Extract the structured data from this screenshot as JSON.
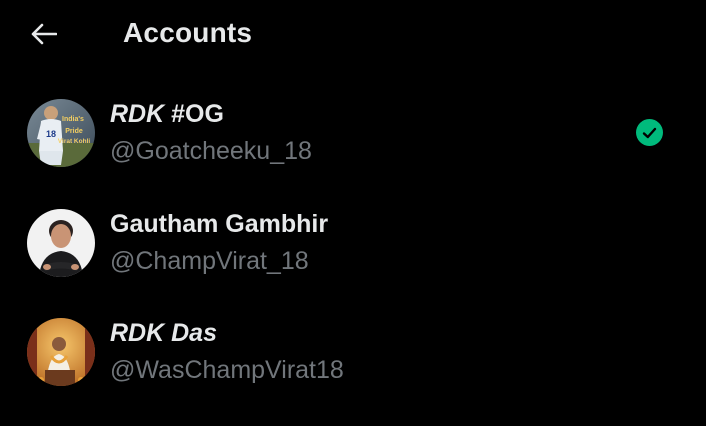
{
  "header": {
    "title": "Accounts",
    "back_icon": "arrow-left-icon"
  },
  "accounts": [
    {
      "name_styled": "RDK",
      "name_rest": " #OG",
      "handle": "@Goatcheeku_18",
      "avatar_text_1": "India's",
      "avatar_text_2": "Pride",
      "avatar_text_3": "Virat Kohli",
      "jersey_number": "18",
      "selected": true
    },
    {
      "name_styled": "",
      "name_rest": "Gautham Gambhir",
      "handle": "@ChampVirat_18",
      "selected": false
    },
    {
      "name_styled": "RDK Das",
      "name_rest": "",
      "handle": "@WasChampVirat18",
      "selected": false
    }
  ],
  "colors": {
    "background": "#000000",
    "text_primary": "#e7e9ea",
    "text_secondary": "#71767b",
    "accent_check": "#00ba7c"
  },
  "icons": {
    "selected": "check-circle-icon"
  }
}
